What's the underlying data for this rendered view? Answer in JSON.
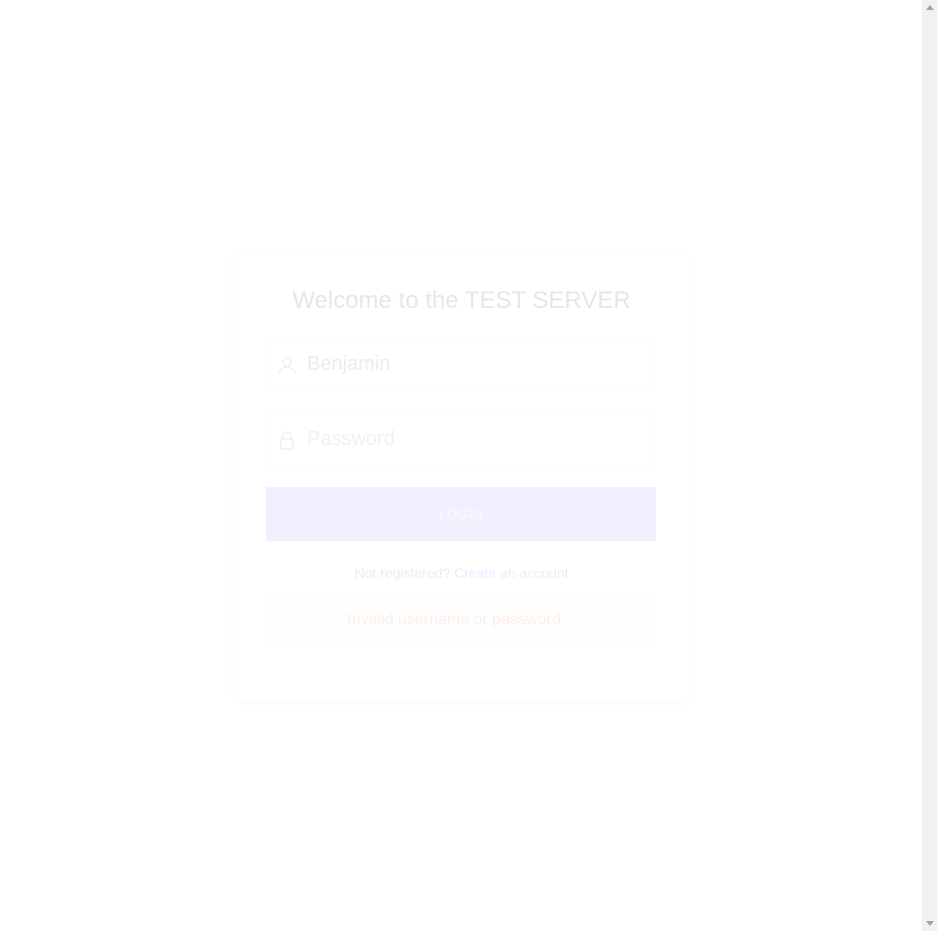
{
  "login": {
    "title": "Welcome to the TEST SERVER",
    "username": {
      "value": "Benjamin",
      "icon": "user-icon"
    },
    "password": {
      "placeholder": "Password",
      "icon": "lock-icon"
    },
    "login_label": "LOGIN",
    "register_prompt": "Not registered?",
    "register_link": "Create an account",
    "error": "Invalid username or password"
  },
  "colors": {
    "button": "#f2f0fe",
    "link": "#e3effd",
    "error": "#fdf0e8"
  }
}
